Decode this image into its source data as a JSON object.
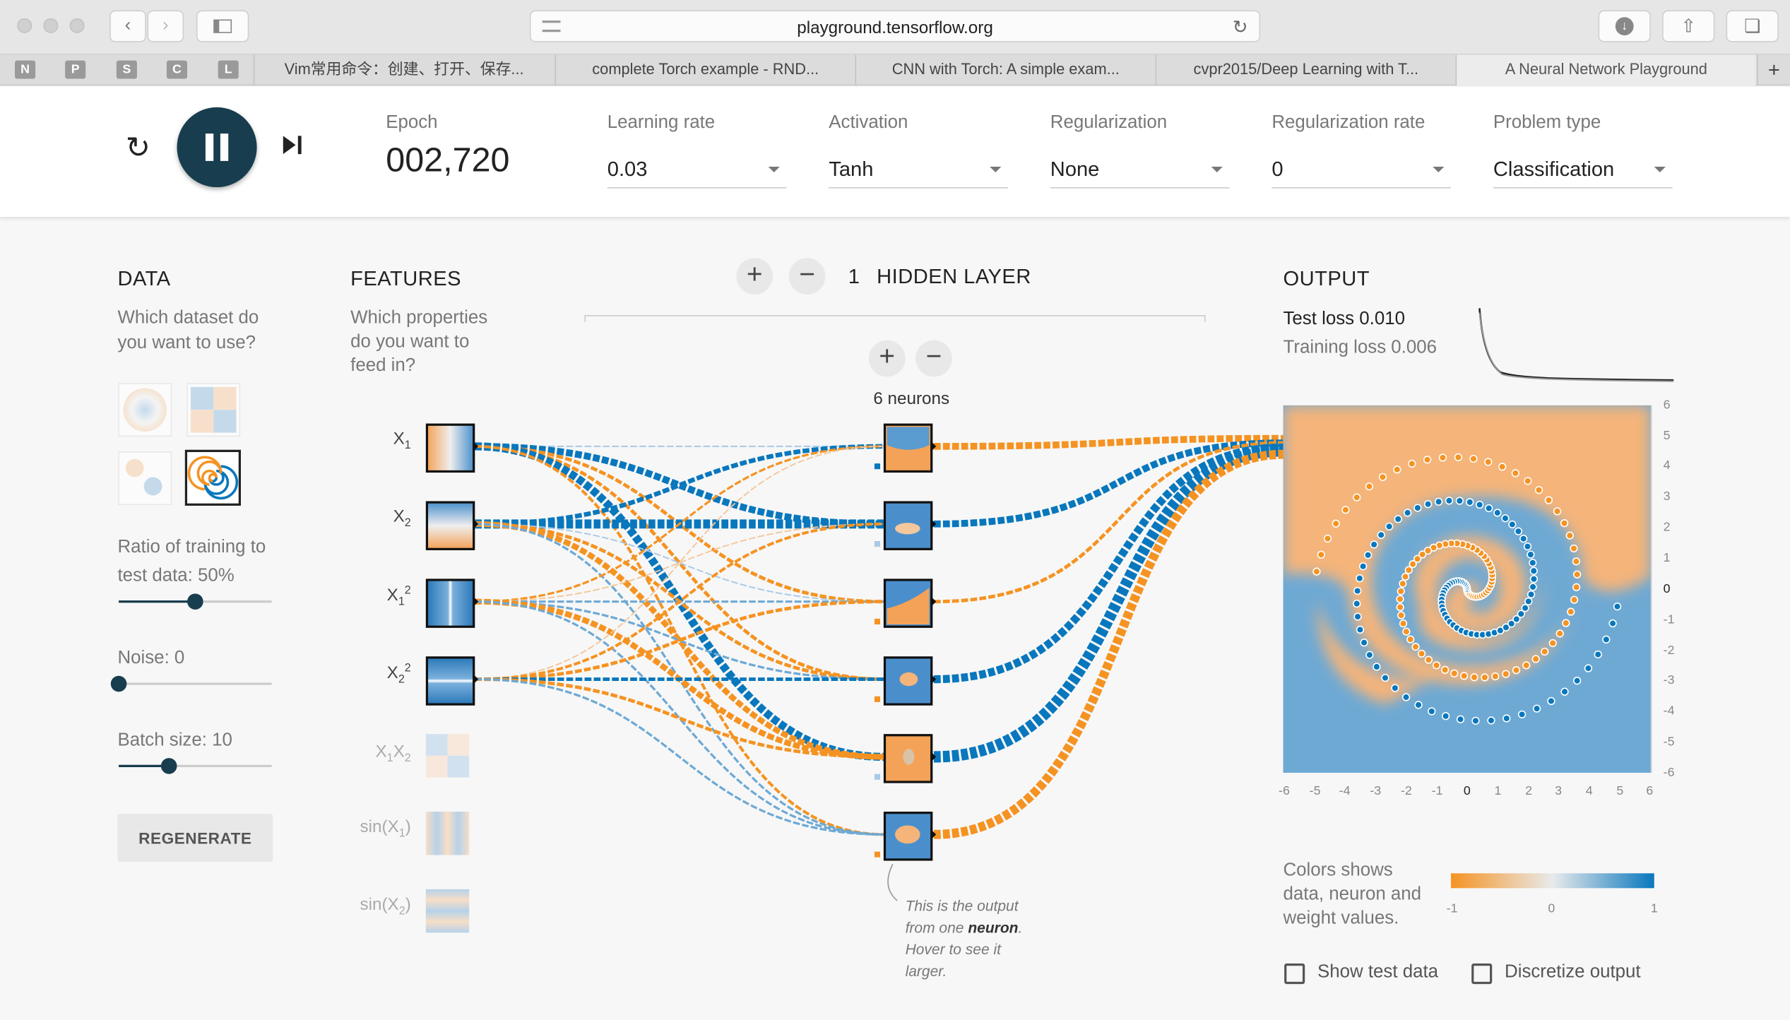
{
  "browser": {
    "url": "playground.tensorflow.org",
    "favicons": [
      "N",
      "P",
      "S",
      "C",
      "L"
    ],
    "tabs": [
      {
        "label": "Vim常用命令：创建、打开、保存..."
      },
      {
        "label": "complete Torch example - RND..."
      },
      {
        "label": "CNN with Torch: A simple exam..."
      },
      {
        "label": "cvpr2015/Deep Learning with T..."
      },
      {
        "label": "A Neural Network Playground"
      }
    ],
    "new_tab_label": "+"
  },
  "controls": {
    "epoch_label": "Epoch",
    "epoch_value": "002,720",
    "learning_rate": {
      "label": "Learning rate",
      "value": "0.03"
    },
    "activation": {
      "label": "Activation",
      "value": "Tanh"
    },
    "regularization": {
      "label": "Regularization",
      "value": "None"
    },
    "regularization_rate": {
      "label": "Regularization rate",
      "value": "0"
    },
    "problem_type": {
      "label": "Problem type",
      "value": "Classification"
    }
  },
  "data_panel": {
    "title": "DATA",
    "question": [
      "Which dataset do",
      "you want to use?"
    ],
    "ratio_label": [
      "Ratio of training to",
      "test data:  50%"
    ],
    "ratio_value": 0.5,
    "noise_label": "Noise:  0",
    "noise_value": 0,
    "batch_label": "Batch size:  10",
    "batch_value": 0.33,
    "regenerate_label": "REGENERATE"
  },
  "features_panel": {
    "title": "FEATURES",
    "question": [
      "Which properties",
      "do you want to",
      "feed in?"
    ],
    "features": [
      {
        "label": "X",
        "sub": "1",
        "sup": "",
        "active": true
      },
      {
        "label": "X",
        "sub": "2",
        "sup": "",
        "active": true
      },
      {
        "label": "X",
        "sub": "1",
        "sup": "2",
        "active": true
      },
      {
        "label": "X",
        "sub": "2",
        "sup": "2",
        "active": true
      },
      {
        "label": "X",
        "sub": "1",
        "mid": "X",
        "sub2": "2",
        "active": false
      },
      {
        "label": "sin(X",
        "sub": "1",
        "tail": ")",
        "active": false
      },
      {
        "label": "sin(X",
        "sub": "2",
        "tail": ")",
        "active": false
      }
    ]
  },
  "hidden": {
    "count": "1",
    "title": "HIDDEN LAYER",
    "neurons_label": "6 neurons",
    "tooltip": {
      "before": "This is the output from one ",
      "bold": "neuron",
      "after": ". Hover to see it larger."
    }
  },
  "output": {
    "title": "OUTPUT",
    "test_loss": "Test loss 0.010",
    "training_loss": "Training loss 0.006",
    "axis_ticks": [
      "-6",
      "-5",
      "-4",
      "-3",
      "-2",
      "-1",
      "0",
      "1",
      "2",
      "3",
      "4",
      "5",
      "6"
    ],
    "y_ticks": [
      "6",
      "5",
      "4",
      "3",
      "2",
      "1",
      "0",
      "-1",
      "-2",
      "-3",
      "-4",
      "-5",
      "-6"
    ],
    "legend_text": [
      "Colors shows",
      "data, neuron and",
      "weight values."
    ],
    "legend_ticks": [
      "-1",
      "0",
      "1"
    ],
    "show_test_data": "Show test data",
    "discretize_output": "Discretize output"
  },
  "colors": {
    "orange": "#f59322",
    "blue": "#0877bd",
    "dark": "#183d4e",
    "orange_light": "#f4b47a",
    "blue_light": "#6ea9d4"
  }
}
